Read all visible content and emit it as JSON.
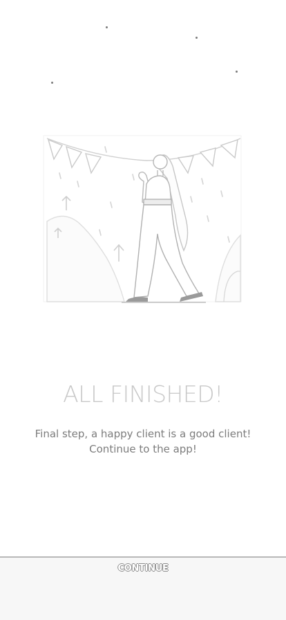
{
  "screen": {
    "background": "#ffffff",
    "illustration": "celebration-illustration"
  },
  "content": {
    "headline": "ALL FINISHED!",
    "message_line1": "Final step, a happy client is a good client!",
    "message_line2": "Continue to the app!"
  },
  "footer": {
    "continue_label": "CONTINUE",
    "bar_color": "#f7f7f7"
  }
}
